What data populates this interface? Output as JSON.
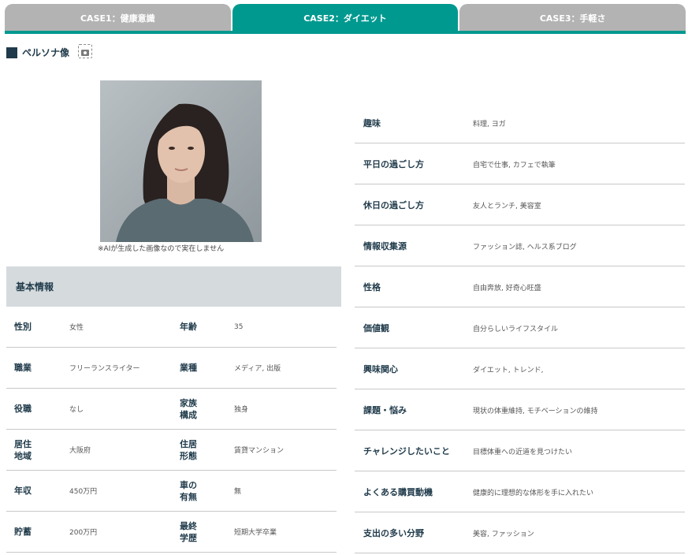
{
  "tabs": [
    {
      "label": "CASE1：健康意識",
      "active": false
    },
    {
      "label": "CASE2：ダイエット",
      "active": true
    },
    {
      "label": "CASE3：手軽さ",
      "active": false
    }
  ],
  "persona": {
    "title": "ペルソナ像",
    "caption": "※AIが生成した画像なので実在しません"
  },
  "basic": {
    "heading": "基本情報",
    "rows": [
      {
        "l1": "性別",
        "v1": "女性",
        "l2": "年齢",
        "v2": "35"
      },
      {
        "l1": "職業",
        "v1": "フリーランスライター",
        "l2": "業種",
        "v2": "メディア, 出版"
      },
      {
        "l1": "役職",
        "v1": "なし",
        "l2": "家族\n構成",
        "v2": "独身"
      },
      {
        "l1": "居住\n地域",
        "v1": "大阪府",
        "l2": "住居\n形態",
        "v2": "賃貸マンション"
      },
      {
        "l1": "年収",
        "v1": "450万円",
        "l2": "車の\n有無",
        "v2": "無"
      },
      {
        "l1": "貯蓄",
        "v1": "200万円",
        "l2": "最終\n学歴",
        "v2": "短期大学卒業"
      }
    ]
  },
  "details": [
    {
      "label": "趣味",
      "value": "料理, ヨガ"
    },
    {
      "label": "平日の過ごし方",
      "value": "自宅で仕事, カフェで執筆"
    },
    {
      "label": "休日の過ごし方",
      "value": "友人とランチ, 美容室"
    },
    {
      "label": "情報収集源",
      "value": "ファッション誌, ヘルス系ブログ"
    },
    {
      "label": "性格",
      "value": "自由奔放, 好奇心旺盛"
    },
    {
      "label": "価値観",
      "value": "自分らしいライフスタイル"
    },
    {
      "label": "興味関心",
      "value": "ダイエット, トレンド,"
    },
    {
      "label": "課題・悩み",
      "value": "現状の体重維持, モチベーションの維持"
    },
    {
      "label": "チャレンジしたいこと",
      "value": "目標体重への近道を見つけたい"
    },
    {
      "label": "よくある購買動機",
      "value": "健康的に理想的な体形を手に入れたい"
    },
    {
      "label": "支出の多い分野",
      "value": "美容, ファッション"
    }
  ],
  "colors": {
    "accent": "#00998f",
    "tab_inactive": "#b3b3b3",
    "heading_bg": "#d5dadd",
    "text_dark": "#1f3a4a"
  },
  "icons": {
    "section_marker": "square-icon",
    "camera": "camera-icon"
  }
}
